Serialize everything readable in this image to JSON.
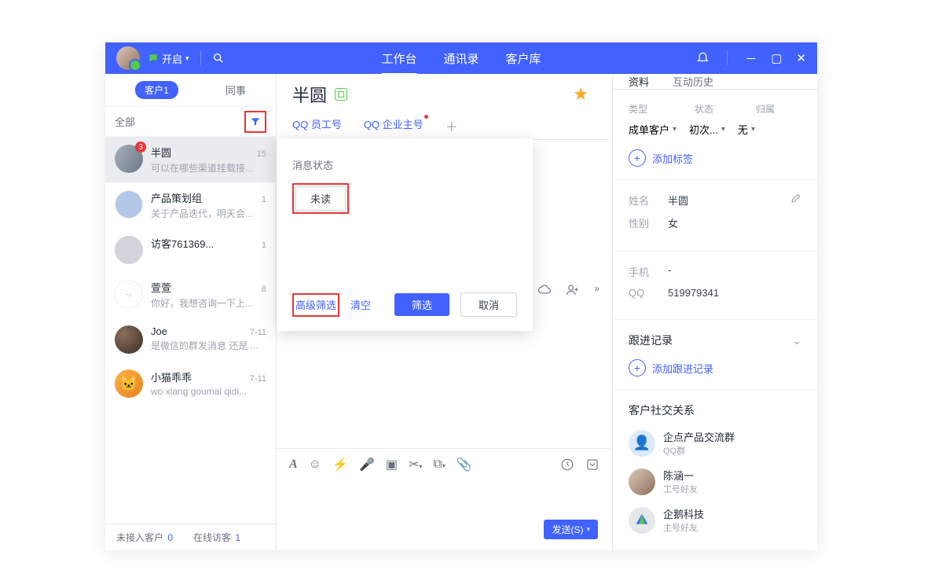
{
  "titlebar": {
    "open_label": "开启",
    "nav": {
      "workspace": "工作台",
      "contacts": "通讯录",
      "customers": "客户库"
    },
    "nav_active": "工作台"
  },
  "sidebar": {
    "tabs": {
      "customer_label": "客户",
      "customer_count": "1",
      "colleague": "同事"
    },
    "filter_label": "全部",
    "items": [
      {
        "name": "半圆",
        "time": "15",
        "preview": "可以在哪些渠道挂载接...",
        "badge": "3"
      },
      {
        "name": "产品策划组",
        "time": "1",
        "preview": "关于产品迭代，明天会..."
      },
      {
        "name": "访客761369...",
        "time": "1",
        "preview": ""
      },
      {
        "name": "萱萱",
        "time": "8",
        "preview": "你好，我想咨询一下上..."
      },
      {
        "name": "Joe",
        "time": "7-11",
        "preview": "是微信的群发消息 还是 ..."
      },
      {
        "name": "小猫乖乖",
        "time": "7-11",
        "preview": "wo xiang goumai qidi..."
      }
    ],
    "footer": {
      "pending_label": "未接入客户",
      "pending_count": "0",
      "online_label": "在线访客",
      "online_count": "1"
    }
  },
  "chat": {
    "title": "半圆",
    "subtabs": {
      "t1": "QQ 员工号",
      "t2": "QQ 企业主号"
    },
    "send_label": "发送(S)"
  },
  "filter_popup": {
    "title": "消息状态",
    "tag_unread": "未读",
    "advanced": "高级筛选",
    "clear": "清空",
    "filter_btn": "筛选",
    "cancel": "取消"
  },
  "info": {
    "tabs": {
      "t1": "资料",
      "t2": "互动历史"
    },
    "type_label": "类型",
    "type_value": "成单客户",
    "status_label": "状态",
    "status_value": "初次...",
    "owner_label": "归属",
    "owner_value": "无",
    "add_tag": "添加标签",
    "name_label": "姓名",
    "name_value": "半圆",
    "gender_label": "性别",
    "gender_value": "女",
    "phone_label": "手机",
    "phone_value": "-",
    "qq_label": "QQ",
    "qq_value": "519979341",
    "follow_title": "跟进记录",
    "follow_add": "添加跟进记录",
    "social_title": "客户社交关系",
    "social": [
      {
        "name": "企点产品交流群",
        "sub": "QQ群"
      },
      {
        "name": "陈涵一",
        "sub": "工号好友"
      },
      {
        "name": "企鹅科技",
        "sub": "主号好友"
      }
    ]
  }
}
